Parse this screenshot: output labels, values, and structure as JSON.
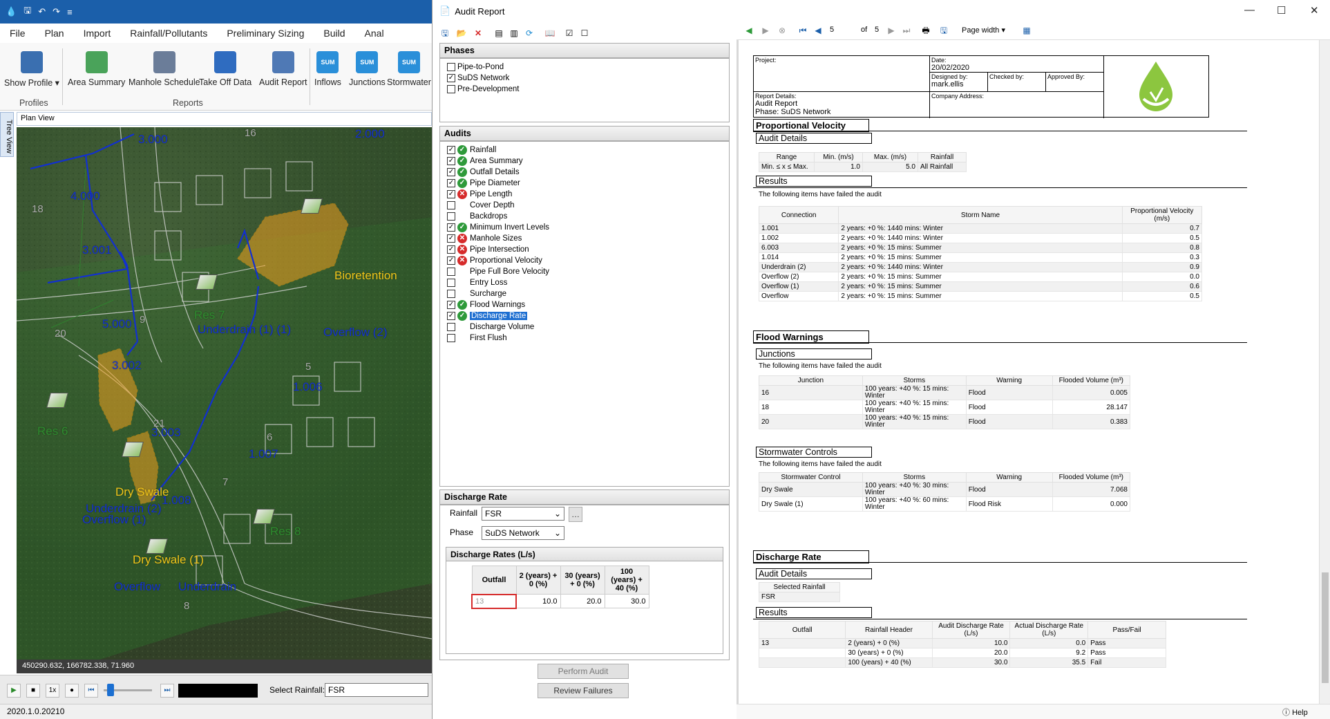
{
  "app": {
    "menu": [
      "File",
      "Plan",
      "Import",
      "Rainfall/Pollutants",
      "Preliminary Sizing",
      "Build",
      "Anal"
    ],
    "ribbon": {
      "buttons": [
        {
          "label": "Show Profile ▾",
          "icon": "profile-icon",
          "color": "#3a6fb0"
        },
        {
          "label": "Area Summary",
          "icon": "area-summary-icon",
          "color": "#4aa35a"
        },
        {
          "label": "Manhole Schedule",
          "icon": "manhole-schedule-icon",
          "color": "#6b7d99"
        },
        {
          "label": "Take Off Data",
          "icon": "cart-icon",
          "color": "#2f6cc0"
        },
        {
          "label": "Audit Report",
          "icon": "audit-report-icon",
          "color": "#4f79b5"
        },
        {
          "label": "Inflows",
          "icon": "sum-icon",
          "color": "#2a8fd9"
        },
        {
          "label": "Junctions",
          "icon": "sum-icon",
          "color": "#2a8fd9"
        },
        {
          "label": "Stormwater",
          "icon": "sum-icon",
          "color": "#2a8fd9"
        }
      ],
      "groups": [
        "Profiles",
        "Reports"
      ]
    },
    "tree_tab": "Tree View",
    "plan_view": "Plan View",
    "map_labels": [
      {
        "text": "3.000",
        "c": "#1230d0"
      },
      {
        "text": "4.000",
        "c": "#1230d0"
      },
      {
        "text": "3.001",
        "c": "#1230d0"
      },
      {
        "text": "5.000",
        "c": "#1230d0"
      },
      {
        "text": "3.002",
        "c": "#1230d0"
      },
      {
        "text": "3.003",
        "c": "#1230d0"
      },
      {
        "text": "1.006",
        "c": "#1230d0"
      },
      {
        "text": "1.007",
        "c": "#1230d0"
      },
      {
        "text": "1.008",
        "c": "#1230d0"
      },
      {
        "text": "2.000",
        "c": "#1230d0"
      },
      {
        "text": "Bioretention",
        "c": "#f0c419"
      },
      {
        "text": "Underdrain (1) (1)",
        "c": "#1230d0"
      },
      {
        "text": "Overflow (2)",
        "c": "#1230d0"
      },
      {
        "text": "Dry Swale",
        "c": "#f0c419"
      },
      {
        "text": "Underdrain (2)",
        "c": "#1230d0"
      },
      {
        "text": "Overflow (1)",
        "c": "#1230d0"
      },
      {
        "text": "Dry Swale (1)",
        "c": "#f0c419"
      },
      {
        "text": "Overflow",
        "c": "#1230d0"
      },
      {
        "text": "Underdrain",
        "c": "#1230d0"
      },
      {
        "text": "Res 6",
        "c": "#2e8b2e"
      },
      {
        "text": "Res 7",
        "c": "#2e8b2e"
      },
      {
        "text": "Res 8",
        "c": "#2e8b2e"
      },
      {
        "text": "16",
        "c": "#aaaaaa"
      },
      {
        "text": "18",
        "c": "#aaaaaa"
      },
      {
        "text": "20",
        "c": "#aaaaaa"
      },
      {
        "text": "9",
        "c": "#aaaaaa"
      },
      {
        "text": "5",
        "c": "#aaaaaa"
      },
      {
        "text": "6",
        "c": "#aaaaaa"
      },
      {
        "text": "21",
        "c": "#aaaaaa"
      },
      {
        "text": "7",
        "c": "#aaaaaa"
      },
      {
        "text": "8",
        "c": "#aaaaaa"
      }
    ],
    "coords": "450290.632, 166782.338, 71.960",
    "play_speed": "1x",
    "select_rainfall_label": "Select Rainfall:",
    "select_rainfall_value": "FSR",
    "version": "2020.1.0.20210"
  },
  "audit": {
    "title": "Audit Report",
    "phases_title": "Phases",
    "phases": [
      {
        "label": "Pipe-to-Pond",
        "checked": false
      },
      {
        "label": "SuDS Network",
        "checked": true
      },
      {
        "label": "Pre-Development",
        "checked": false
      }
    ],
    "audits_title": "Audits",
    "audits": [
      {
        "label": "Rainfall",
        "checked": true,
        "status": "ok"
      },
      {
        "label": "Area Summary",
        "checked": true,
        "status": "ok"
      },
      {
        "label": "Outfall Details",
        "checked": true,
        "status": "ok"
      },
      {
        "label": "Pipe Diameter",
        "checked": true,
        "status": "ok"
      },
      {
        "label": "Pipe Length",
        "checked": true,
        "status": "bad"
      },
      {
        "label": "Cover Depth",
        "checked": false,
        "status": "none"
      },
      {
        "label": "Backdrops",
        "checked": false,
        "status": "none"
      },
      {
        "label": "Minimum Invert Levels",
        "checked": true,
        "status": "ok"
      },
      {
        "label": "Manhole Sizes",
        "checked": true,
        "status": "bad"
      },
      {
        "label": "Pipe Intersection",
        "checked": true,
        "status": "bad"
      },
      {
        "label": "Proportional Velocity",
        "checked": true,
        "status": "bad"
      },
      {
        "label": "Pipe Full Bore Velocity",
        "checked": false,
        "status": "none"
      },
      {
        "label": "Entry Loss",
        "checked": false,
        "status": "none"
      },
      {
        "label": "Surcharge",
        "checked": false,
        "status": "none"
      },
      {
        "label": "Flood Warnings",
        "checked": true,
        "status": "ok"
      },
      {
        "label": "Discharge Rate",
        "checked": true,
        "status": "ok",
        "selected": true
      },
      {
        "label": "Discharge Volume",
        "checked": false,
        "status": "none"
      },
      {
        "label": "First Flush",
        "checked": false,
        "status": "none"
      }
    ],
    "dr_title": "Discharge Rate",
    "rainfall_label": "Rainfall",
    "rainfall_value": "FSR",
    "phase_label": "Phase",
    "phase_value": "SuDS Network",
    "dr_table_title": "Discharge Rates (L/s)",
    "dr_headers": [
      "Outfall",
      "2 (years) + 0 (%)",
      "30 (years) + 0 (%)",
      "100 (years) + 40 (%)"
    ],
    "dr_row": [
      "13",
      "10.0",
      "20.0",
      "30.0"
    ],
    "perform_btn": "Perform Audit",
    "review_btn": "Review Failures"
  },
  "viewer": {
    "page_num": "5",
    "page_of": "of",
    "page_total": "5",
    "zoom": "Page width",
    "hdr": {
      "project_label": "Project:",
      "date_label": "Date:",
      "date": "20/02/2020",
      "designed_label": "Designed by:",
      "designed": "mark.ellis",
      "checked_label": "Checked by:",
      "approved_label": "Approved By:",
      "details_label": "Report Details:",
      "report_type": "Audit Report",
      "phase": "Phase: SuDS Network",
      "company_label": "Company Address:"
    },
    "pv": {
      "title": "Proportional Velocity",
      "audit_details": "Audit Details",
      "ad_headers": [
        "Range",
        "Min. (m/s)",
        "Max. (m/s)",
        "Rainfall"
      ],
      "ad_row": [
        "Min. ≤ x ≤ Max.",
        "1.0",
        "5.0",
        "All Rainfall"
      ],
      "results": "Results",
      "note": "The following items have failed the audit",
      "headers": [
        "Connection",
        "Storm Name",
        "Proportional Velocity (m/s)"
      ],
      "rows": [
        [
          "1.001",
          "2 years: +0 %: 1440 mins: Winter",
          "0.7"
        ],
        [
          "1.002",
          "2 years: +0 %: 1440 mins: Winter",
          "0.5"
        ],
        [
          "6.003",
          "2 years: +0 %: 15 mins: Summer",
          "0.8"
        ],
        [
          "1.014",
          "2 years: +0 %: 15 mins: Summer",
          "0.3"
        ],
        [
          "Underdrain (2)",
          "2 years: +0 %: 1440 mins: Winter",
          "0.9"
        ],
        [
          "Overflow (2)",
          "2 years: +0 %: 15 mins: Summer",
          "0.0"
        ],
        [
          "Overflow (1)",
          "2 years: +0 %: 15 mins: Summer",
          "0.6"
        ],
        [
          "Overflow",
          "2 years: +0 %: 15 mins: Summer",
          "0.5"
        ]
      ]
    },
    "fw": {
      "title": "Flood Warnings",
      "junctions": "Junctions",
      "note": "The following items have failed the audit",
      "j_headers": [
        "Junction",
        "Storms",
        "Warning",
        "Flooded Volume (m³)"
      ],
      "j_rows": [
        [
          "16",
          "100 years: +40 %: 15 mins: Winter",
          "Flood",
          "0.005"
        ],
        [
          "18",
          "100 years: +40 %: 15 mins: Winter",
          "Flood",
          "28.147"
        ],
        [
          "20",
          "100 years: +40 %: 15 mins: Winter",
          "Flood",
          "0.383"
        ]
      ],
      "sc": "Stormwater Controls",
      "s_headers": [
        "Stormwater Control",
        "Storms",
        "Warning",
        "Flooded Volume (m³)"
      ],
      "s_rows": [
        [
          "Dry Swale",
          "100 years: +40 %: 30 mins: Winter",
          "Flood",
          "7.068"
        ],
        [
          "Dry Swale (1)",
          "100 years: +40 %: 60 mins: Winter",
          "Flood Risk",
          "0.000"
        ]
      ]
    },
    "dr": {
      "title": "Discharge Rate",
      "audit_details": "Audit Details",
      "sel_header": "Selected Rainfall",
      "sel_value": "FSR",
      "results": "Results",
      "headers": [
        "Outfall",
        "Rainfall Header",
        "Audit Discharge Rate (L/s)",
        "Actual Discharge Rate (L/s)",
        "Pass/Fail"
      ],
      "rows": [
        [
          "13",
          "2 (years) + 0 (%)",
          "10.0",
          "0.0",
          "Pass"
        ],
        [
          "",
          "30 (years) + 0 (%)",
          "20.0",
          "9.2",
          "Pass"
        ],
        [
          "",
          "100 (years) + 40 (%)",
          "30.0",
          "35.5",
          "Fail"
        ]
      ]
    },
    "help": "Help"
  }
}
